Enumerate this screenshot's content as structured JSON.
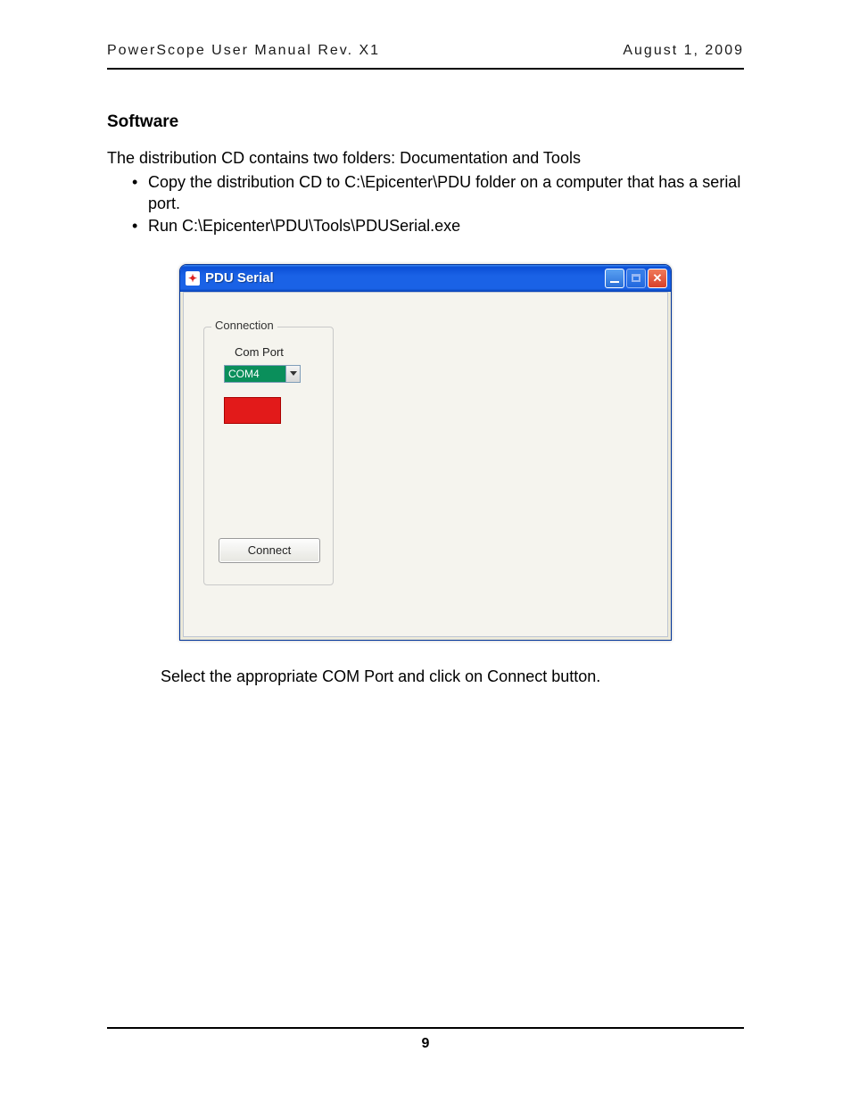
{
  "header": {
    "left": "PowerScope User Manual Rev. X1",
    "right": "August 1, 2009"
  },
  "section_title": "Software",
  "intro": "The distribution CD contains two folders: Documentation and Tools",
  "bullets": [
    "Copy the distribution CD to C:\\Epicenter\\PDU folder on a computer that has a serial port.",
    "Run C:\\Epicenter\\PDU\\Tools\\PDUSerial.exe"
  ],
  "window": {
    "title": "PDU Serial",
    "group_legend": "Connection",
    "field_label": "Com Port",
    "combo_value": "COM4",
    "connect_label": "Connect"
  },
  "caption": "Select the appropriate COM Port and click on Connect button.",
  "page_number": "9"
}
